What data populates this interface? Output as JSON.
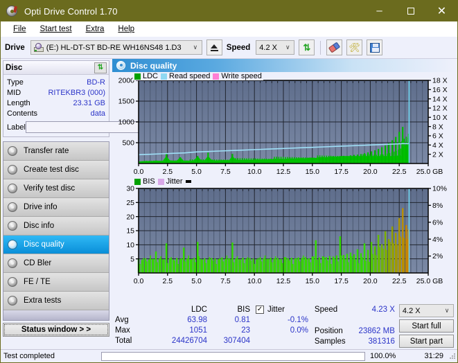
{
  "window": {
    "title": "Opti Drive Control 1.70",
    "icon": "disc-icon",
    "minimize": "–",
    "maximize": "□",
    "close": "✕",
    "titlebar_color": "#6b6b1e"
  },
  "menu": [
    {
      "label": "File",
      "accel": "F"
    },
    {
      "label": "Start test",
      "accel": "S"
    },
    {
      "label": "Extra",
      "accel": "x"
    },
    {
      "label": "Help",
      "accel": "H"
    }
  ],
  "toolbar": {
    "drive_label": "Drive",
    "drive_value": "(E:)  HL-DT-ST BD-RE  WH16NS48 1.D3",
    "drive_icon": "optical-drive-icon",
    "eject_icon": "eject-icon",
    "speed_label": "Speed",
    "speed_value": "4.2 X",
    "refresh_icon": "refresh-icon",
    "eraser_icon": "eraser-icon",
    "tools_icon": "tools-icon",
    "save_icon": "save-icon",
    "dropdown_arrow": "∨"
  },
  "disc_panel": {
    "title": "Disc",
    "refresh_icon": "refresh-icon",
    "rows": [
      {
        "key": "Type",
        "value": "BD-R"
      },
      {
        "key": "MID",
        "value": "RITEKBR3 (000)"
      },
      {
        "key": "Length",
        "value": "23.31 GB"
      },
      {
        "key": "Contents",
        "value": "data"
      }
    ],
    "label_key": "Label",
    "label_value": "",
    "label_placeholder": "",
    "label_button_icon": "cd-icon"
  },
  "sidebar": {
    "items": [
      {
        "label": "Transfer rate",
        "icon": "disc-transfer-icon",
        "active": false
      },
      {
        "label": "Create test disc",
        "icon": "disc-create-icon",
        "active": false
      },
      {
        "label": "Verify test disc",
        "icon": "disc-verify-icon",
        "active": false
      },
      {
        "label": "Drive info",
        "icon": "disc-drive-icon",
        "active": false
      },
      {
        "label": "Disc info",
        "icon": "disc-info-icon",
        "active": false
      },
      {
        "label": "Disc quality",
        "icon": "disc-quality-icon",
        "active": true
      },
      {
        "label": "CD Bler",
        "icon": "disc-bler-icon",
        "active": false
      },
      {
        "label": "FE / TE",
        "icon": "disc-fete-icon",
        "active": false
      },
      {
        "label": "Extra tests",
        "icon": "disc-extra-icon",
        "active": false
      }
    ],
    "status_button": "Status window > >"
  },
  "content": {
    "header_title": "Disc quality",
    "header_icon": "disc-quality-icon"
  },
  "chart_data": [
    {
      "type": "area",
      "name": "ldc-chart",
      "title": "",
      "xlabel": "GB",
      "ylabel": "LDC",
      "legend": [
        {
          "label": "LDC",
          "color": "#00a000"
        },
        {
          "label": "Read speed",
          "color": "#8fd8f2"
        },
        {
          "label": "Write speed",
          "color": "#ff7fd4"
        }
      ],
      "legend_position": "top-left",
      "grid": true,
      "xlim": [
        0.0,
        25.0
      ],
      "xticks": [
        "0.0",
        "2.5",
        "5.0",
        "7.5",
        "10.0",
        "12.5",
        "15.0",
        "17.5",
        "20.0",
        "22.5",
        "25.0 GB"
      ],
      "ylim": [
        0,
        2000
      ],
      "yticks": [
        "500",
        "1000",
        "1500",
        "2000"
      ],
      "y2lim": [
        0,
        18
      ],
      "y2ticks": [
        "2 X",
        "4 X",
        "6 X",
        "8 X",
        "10 X",
        "12 X",
        "14 X",
        "16 X",
        "18 X"
      ],
      "series": [
        {
          "name": "LDC",
          "color": "#00c000",
          "x": [
            0.0,
            0.3,
            0.6,
            0.9,
            1.2,
            1.5,
            1.8,
            2.1,
            2.4,
            2.7,
            3.0,
            3.3,
            3.6,
            3.9,
            4.2,
            4.5,
            4.8,
            5.1,
            5.4,
            5.7,
            6.0,
            6.3,
            6.6,
            6.9,
            7.2,
            7.5,
            7.8,
            8.1,
            8.4,
            8.7,
            9.0,
            9.3,
            9.6,
            9.9,
            10.2,
            10.5,
            10.8,
            11.1,
            11.4,
            11.7,
            12.0,
            12.3,
            12.6,
            12.9,
            13.2,
            13.5,
            13.8,
            14.1,
            14.4,
            14.7,
            15.0,
            15.3,
            15.6,
            15.9,
            16.2,
            16.5,
            16.8,
            17.1,
            17.4,
            17.7,
            18.0,
            18.3,
            18.6,
            18.9,
            19.2,
            19.5,
            19.8,
            20.1,
            20.4,
            20.7,
            21.0,
            21.3,
            21.6,
            21.9,
            22.2,
            22.5,
            22.8,
            23.1,
            23.3
          ],
          "values": [
            45,
            55,
            60,
            52,
            58,
            70,
            62,
            66,
            240,
            75,
            68,
            72,
            150,
            66,
            70,
            64,
            82,
            180,
            74,
            78,
            260,
            86,
            70,
            74,
            80,
            84,
            76,
            230,
            90,
            82,
            88,
            94,
            86,
            90,
            98,
            92,
            102,
            96,
            104,
            100,
            108,
            112,
            106,
            118,
            122,
            116,
            126,
            130,
            124,
            136,
            142,
            134,
            148,
            154,
            146,
            160,
            168,
            162,
            176,
            184,
            178,
            196,
            208,
            214,
            226,
            246,
            268,
            292,
            318,
            352,
            390,
            436,
            492,
            560,
            640,
            760,
            880,
            520,
            620
          ]
        },
        {
          "name": "Read speed",
          "color": "#8fd8f2",
          "x": [
            0.0,
            1.0,
            2.0,
            3.0,
            4.0,
            5.0,
            6.0,
            7.0,
            8.0,
            9.0,
            10.0,
            11.0,
            12.0,
            13.0,
            14.0,
            15.0,
            16.0,
            17.0,
            18.0,
            19.0,
            20.0,
            21.0,
            22.0,
            22.8,
            23.3
          ],
          "values_x_speed": [
            1.9,
            2.0,
            2.1,
            2.2,
            2.3,
            2.5,
            2.6,
            2.7,
            2.8,
            2.9,
            3.0,
            3.1,
            3.2,
            3.3,
            3.4,
            3.5,
            3.6,
            3.7,
            3.8,
            3.9,
            4.0,
            4.1,
            4.2,
            4.3,
            4.3
          ]
        },
        {
          "name": "Write speed",
          "color": "#ff7fd4",
          "x": [],
          "values": []
        }
      ],
      "end_marker_x": 23.35,
      "end_marker_color": "#6fd6f0"
    },
    {
      "type": "area",
      "name": "bis-chart",
      "title": "",
      "xlabel": "GB",
      "ylabel": "BIS",
      "legend": [
        {
          "label": "BIS",
          "color": "#00a000"
        },
        {
          "label": "Jitter",
          "color": "#d9a8e8"
        }
      ],
      "legend_position": "top-left",
      "grid": true,
      "xlim": [
        0.0,
        25.0
      ],
      "xticks": [
        "0.0",
        "2.5",
        "5.0",
        "7.5",
        "10.0",
        "12.5",
        "15.0",
        "17.5",
        "20.0",
        "22.5",
        "25.0 GB"
      ],
      "ylim": [
        0,
        30
      ],
      "yticks": [
        "5",
        "10",
        "15",
        "20",
        "25",
        "30"
      ],
      "y2lim": [
        0,
        10
      ],
      "y2ticks": [
        "2%",
        "4%",
        "6%",
        "8%",
        "10%"
      ],
      "series": [
        {
          "name": "BIS",
          "color_low": "#35d800",
          "color_high": "#d08000",
          "x": [
            0.0,
            0.3,
            0.6,
            0.9,
            1.2,
            1.5,
            1.8,
            2.1,
            2.4,
            2.7,
            3.0,
            3.3,
            3.6,
            3.9,
            4.2,
            4.5,
            4.8,
            5.1,
            5.4,
            5.7,
            6.0,
            6.3,
            6.6,
            6.9,
            7.2,
            7.5,
            7.8,
            8.1,
            8.4,
            8.7,
            9.0,
            9.3,
            9.6,
            9.9,
            10.2,
            10.5,
            10.8,
            11.1,
            11.4,
            11.7,
            12.0,
            12.3,
            12.6,
            12.9,
            13.2,
            13.5,
            13.8,
            14.1,
            14.4,
            14.7,
            15.0,
            15.3,
            15.6,
            15.9,
            16.2,
            16.5,
            16.8,
            17.1,
            17.4,
            17.7,
            18.0,
            18.3,
            18.6,
            18.9,
            19.2,
            19.5,
            19.8,
            20.1,
            20.4,
            20.7,
            21.0,
            21.3,
            21.6,
            21.9,
            22.2,
            22.5,
            22.8,
            23.1,
            23.3
          ],
          "values": [
            5.0,
            4.6,
            5.2,
            4.8,
            5.0,
            7.6,
            5.1,
            4.9,
            10.5,
            5.2,
            4.8,
            5.3,
            5.0,
            9.0,
            5.1,
            4.9,
            5.4,
            11.0,
            5.0,
            5.2,
            4.8,
            5.3,
            5.1,
            4.9,
            5.5,
            5.0,
            5.2,
            10.8,
            5.1,
            4.9,
            5.4,
            5.0,
            5.3,
            5.1,
            4.8,
            5.5,
            5.2,
            5.0,
            5.4,
            5.1,
            5.3,
            5.0,
            5.6,
            5.2,
            5.4,
            5.1,
            5.5,
            5.3,
            5.6,
            5.2,
            5.8,
            11.6,
            5.5,
            5.9,
            5.6,
            6.0,
            5.8,
            6.2,
            13.0,
            6.4,
            6.8,
            7.2,
            6.6,
            8.4,
            7.0,
            10.5,
            8.2,
            11.0,
            9.4,
            13.5,
            10.2,
            14.8,
            12.0,
            16.5,
            14.2,
            19.5,
            23.0,
            17.0,
            15.5
          ]
        }
      ],
      "end_marker_x": 23.35,
      "end_marker_color": "#6fd6f0"
    }
  ],
  "stats": {
    "col_headers": {
      "ldc": "LDC",
      "bis": "BIS"
    },
    "rows": [
      {
        "key": "Avg",
        "ldc": "63.98",
        "bis": "0.81"
      },
      {
        "key": "Max",
        "ldc": "1051",
        "bis": "23"
      },
      {
        "key": "Total",
        "ldc": "24426704",
        "bis": "307404"
      }
    ],
    "jitter": {
      "label": "Jitter",
      "checked": true,
      "check_glyph": "✓",
      "avg": "-0.1%",
      "max": "0.0%"
    },
    "right": [
      {
        "key": "Speed",
        "value": "4.23 X"
      },
      {
        "key": "Position",
        "value": "23862 MB"
      },
      {
        "key": "Samples",
        "value": "381316"
      }
    ],
    "speed_select": "4.2 X",
    "dropdown_arrow": "∨",
    "start_full": "Start full",
    "start_part": "Start part"
  },
  "statusbar": {
    "text": "Test completed",
    "percent": "100.0%",
    "progress_value": 100,
    "time": "31:29",
    "bar_color": "#14a814"
  }
}
